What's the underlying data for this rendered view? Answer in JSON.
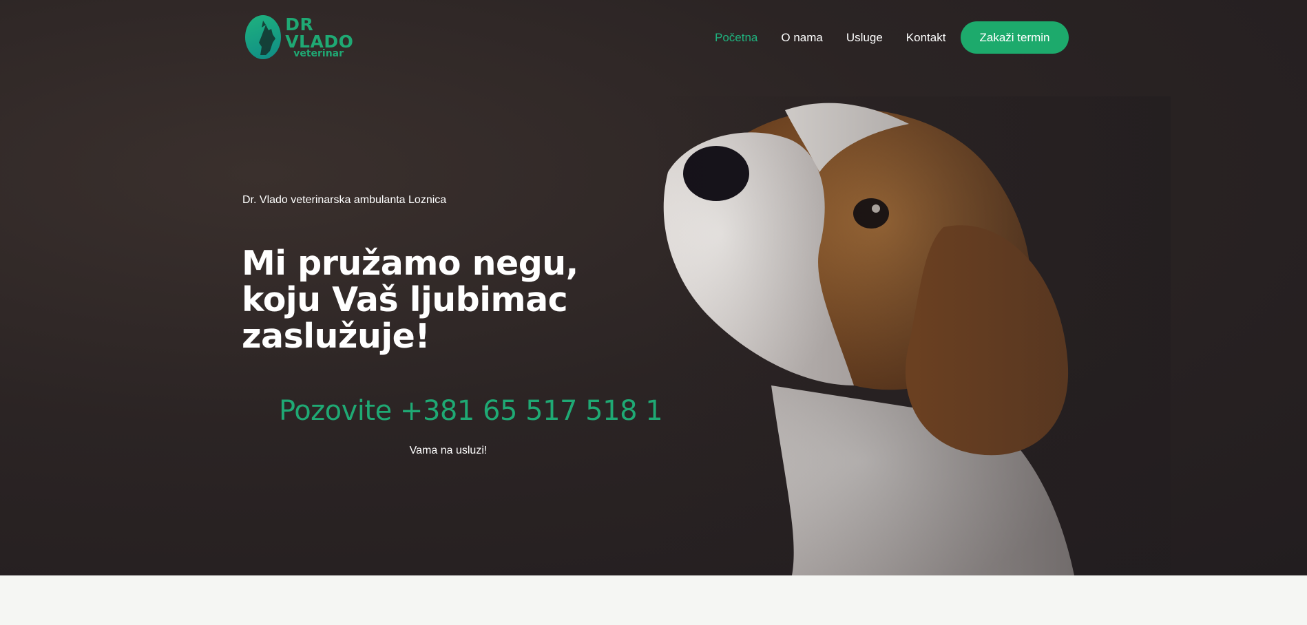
{
  "header": {
    "logo_title": "DR VLADO",
    "logo_subtitle": "veterinar",
    "nav": [
      {
        "label": "Početna",
        "active": true
      },
      {
        "label": "O nama",
        "active": false
      },
      {
        "label": "Usluge",
        "active": false
      },
      {
        "label": "Kontakt",
        "active": false
      }
    ],
    "cta_label": "Zakaži termin"
  },
  "hero": {
    "eyebrow": "Dr. Vlado veterinarska ambulanta Loznica",
    "headline_lines": [
      "Mi pružamo negu,",
      "koju Vaš ljubimac",
      "zaslužuje!"
    ],
    "phone": "Pozovite +381 65 517 518 1",
    "service_note": "Vama na usluzi!"
  },
  "colors": {
    "accent": "#1daa6c",
    "hero_bg": "#2b2424",
    "page_bg": "#f5f6f3"
  }
}
